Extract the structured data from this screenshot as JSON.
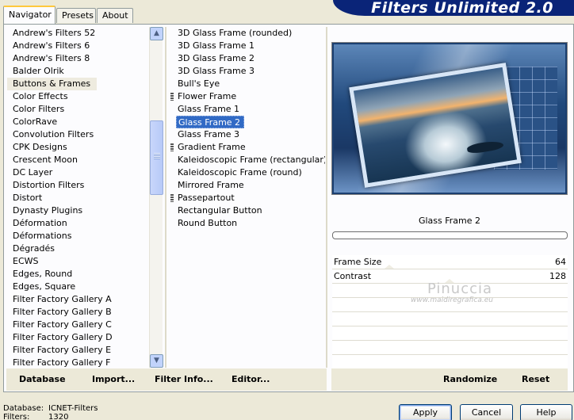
{
  "tabs": [
    {
      "label": "Navigator"
    },
    {
      "label": "Presets"
    },
    {
      "label": "About"
    }
  ],
  "banner": {
    "title": "Filters Unlimited 2.0"
  },
  "categories": [
    "Andrew's Filters 52",
    "Andrew's Filters 6",
    "Andrew's Filters 8",
    "Balder Olrik",
    "Buttons & Frames",
    "Color Effects",
    "Color Filters",
    "ColorRave",
    "Convolution Filters",
    "CPK Designs",
    "Crescent Moon",
    "DC Layer",
    "Distortion Filters",
    "Distort",
    "Dynasty Plugins",
    "Déformation",
    "Déformations",
    "Dégradés",
    "ECWS",
    "Edges, Round",
    "Edges, Square",
    "Filter Factory Gallery A",
    "Filter Factory Gallery B",
    "Filter Factory Gallery C",
    "Filter Factory Gallery D",
    "Filter Factory Gallery E",
    "Filter Factory Gallery F"
  ],
  "selected_category": "Buttons & Frames",
  "filters": [
    "3D Glass Frame (rounded)",
    "3D Glass Frame 1",
    "3D Glass Frame 2",
    "3D Glass Frame 3",
    "Bull's Eye",
    "Flower Frame",
    "Glass Frame 1",
    "Glass Frame 2",
    "Glass Frame 3",
    "Gradient Frame",
    "Kaleidoscopic Frame (rectangular)",
    "Kaleidoscopic Frame (round)",
    "Mirrored Frame",
    "Passepartout",
    "Rectangular Button",
    "Round Button"
  ],
  "selected_filter": "Glass Frame 2",
  "preview": {
    "filter_name": "Glass Frame 2"
  },
  "params": [
    {
      "name": "Frame Size",
      "value": "64"
    },
    {
      "name": "Contrast",
      "value": "128"
    }
  ],
  "watermark": {
    "name": "Pinuccia",
    "url": "www.maidiregrafica.eu"
  },
  "toolbar": {
    "database": "Database",
    "import": "Import...",
    "filter_info": "Filter Info...",
    "editor": "Editor...",
    "randomize": "Randomize",
    "reset": "Reset"
  },
  "status": {
    "database_label": "Database:",
    "database_value": "ICNET-Filters",
    "filters_label": "Filters:",
    "filters_value": "1320"
  },
  "buttons": {
    "apply": "Apply",
    "cancel": "Cancel",
    "help": "Help"
  }
}
